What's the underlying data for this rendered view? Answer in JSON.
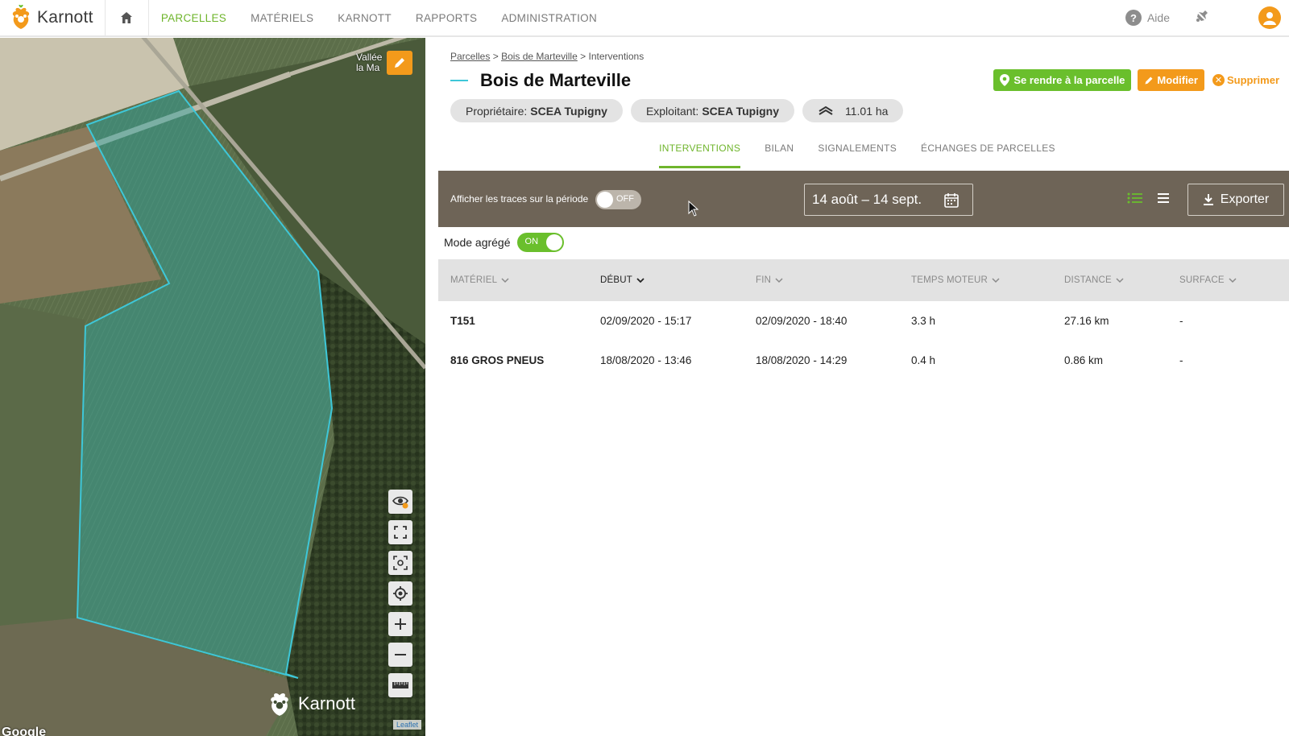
{
  "brand": {
    "name": "Karnott"
  },
  "nav": {
    "items": [
      {
        "label": "PARCELLES"
      },
      {
        "label": "MATÉRIELS"
      },
      {
        "label": "KARNOTT"
      },
      {
        "label": "RAPPORTS"
      },
      {
        "label": "ADMINISTRATION"
      }
    ],
    "help_label": "Aide"
  },
  "map": {
    "place_label_1": "Vallée",
    "place_label_2": "la Ma",
    "watermark": "Karnott",
    "attribution": "Leaflet",
    "google": "Google"
  },
  "breadcrumb": {
    "root": "Parcelles",
    "sep1": ">",
    "parcel": "Bois de Marteville",
    "sep2": ">",
    "current": "Interventions"
  },
  "parcel": {
    "title": "Bois de Marteville",
    "owner_label": "Propriétaire:",
    "owner_value": "SCEA Tupigny",
    "operator_label": "Exploitant:",
    "operator_value": "SCEA Tupigny",
    "area": "11.01 ha"
  },
  "actions": {
    "goto_label": "Se rendre à la parcelle",
    "edit_label": "Modifier",
    "delete_label": "Supprimer"
  },
  "tabs": [
    {
      "label": "INTERVENTIONS"
    },
    {
      "label": "BILAN"
    },
    {
      "label": "SIGNALEMENTS"
    },
    {
      "label": "ÉCHANGES DE PARCELLES"
    }
  ],
  "toolbar": {
    "traces_label": "Afficher les traces sur la période",
    "traces_toggle": "OFF",
    "date_range": "14 août  –  14 sept.",
    "export_label": "Exporter"
  },
  "mode": {
    "label": "Mode agrégé",
    "toggle": "ON"
  },
  "table": {
    "headers": [
      "MATÉRIEL",
      "DÉBUT",
      "FIN",
      "TEMPS MOTEUR",
      "DISTANCE",
      "SURFACE"
    ],
    "rows": [
      {
        "materiel": "T151",
        "debut": "02/09/2020 - 15:17",
        "fin": "02/09/2020 - 18:40",
        "temps": "3.3 h",
        "distance": "27.16 km",
        "surface": "-"
      },
      {
        "materiel": "816 GROS PNEUS",
        "debut": "18/08/2020 - 13:46",
        "fin": "18/08/2020 - 14:29",
        "temps": "0.4 h",
        "distance": "0.86 km",
        "surface": "-"
      }
    ]
  },
  "colors": {
    "accent_green": "#6fb52c",
    "orange": "#f39a1b",
    "toolbar_brown": "#6e6457",
    "parcel_outline": "#3ec7d8"
  }
}
